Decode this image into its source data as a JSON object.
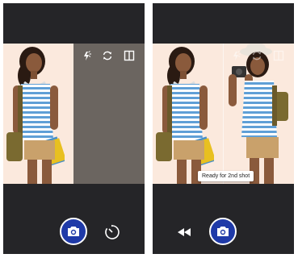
{
  "screens": [
    {
      "id": "first-shot",
      "icons": {
        "flash": "flash-icon",
        "switch": "switch-camera-icon",
        "split": "split-view-icon"
      },
      "actions": {
        "shutter": "shutter-camera-icon",
        "timer": "timer-icon"
      }
    },
    {
      "id": "second-shot",
      "icons": {
        "flash": "flash-icon",
        "switch": "switch-camera-icon",
        "split": "split-view-icon"
      },
      "actions": {
        "shutter": "shutter-camera-icon",
        "rewind": "rewind-icon"
      },
      "toast": "Ready for 2nd shot"
    }
  ],
  "colors": {
    "screen_bg": "#252528",
    "backdrop": "#fbe9dd",
    "gray_panel": "#6b6560",
    "shutter_accent": "#1f3aa8",
    "shirt_stripes": "#5f9fd6",
    "shorts": "#c9a16b"
  }
}
